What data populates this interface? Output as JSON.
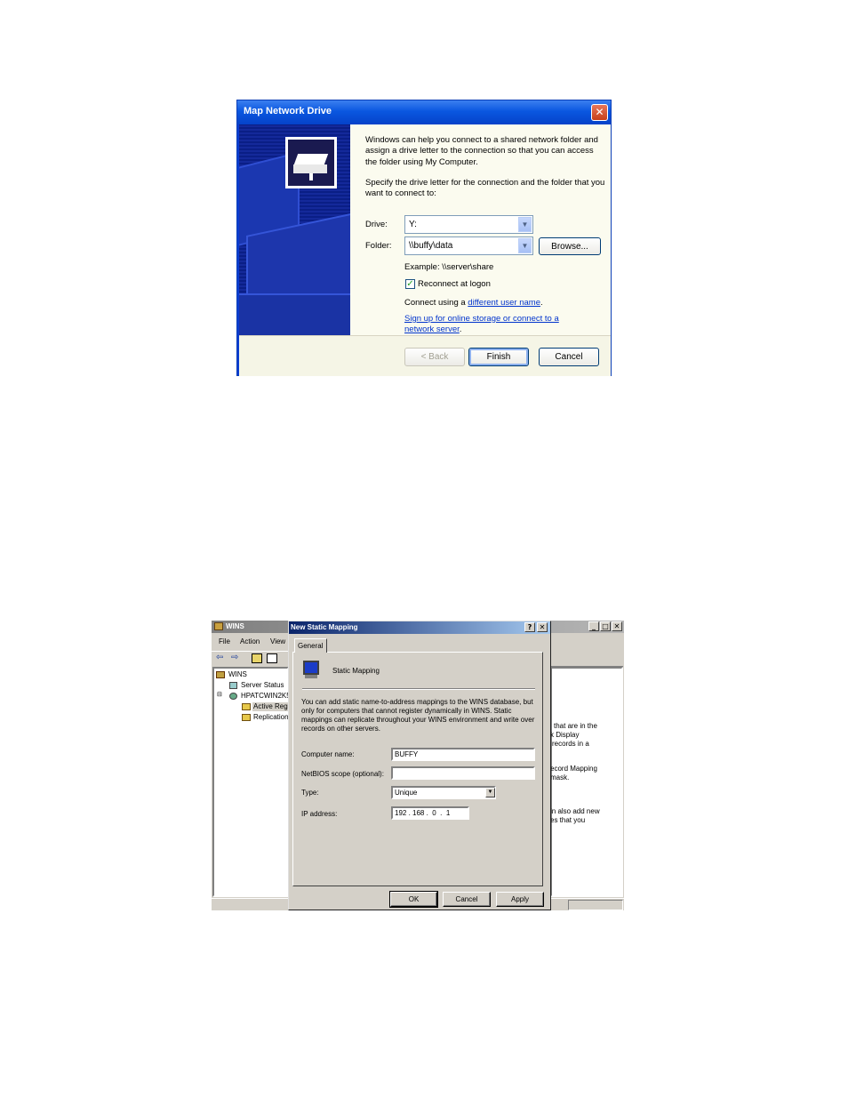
{
  "map_network_drive": {
    "title": "Map Network Drive",
    "intro": "Windows can help you connect to a shared network folder and assign a drive letter to the connection so that you can access the folder using My Computer.",
    "instruction": "Specify the drive letter for the connection and the folder that you want to connect to:",
    "drive_label": "Drive:",
    "drive_value": "Y:",
    "folder_label": "Folder:",
    "folder_value": "\\\\buffy\\data",
    "browse_label": "Browse...",
    "example": "Example: \\\\server\\share",
    "reconnect_label": "Reconnect at logon",
    "reconnect_checked": true,
    "connect_prefix": "Connect using a ",
    "connect_link": "different user name",
    "connect_suffix": ".",
    "signup_link_1": "Sign up for online storage or connect to a",
    "signup_link_2": "network server",
    "signup_suffix": ".",
    "back_label": "< Back",
    "finish_label": "Finish",
    "cancel_label": "Cancel"
  },
  "wins_console": {
    "title": "WINS",
    "menu": [
      "File",
      "Action",
      "View"
    ],
    "tree": {
      "root": "WINS",
      "server_status": "Server Status",
      "server": "HPATCWIN2K5",
      "active_reg": "Active Reg",
      "replication": "Replication"
    },
    "right_fragments": [
      [
        "that are in the",
        "k Display",
        "records in a"
      ],
      [
        "ecord Mapping",
        "mask."
      ],
      [
        "in also add new",
        "es that you"
      ]
    ]
  },
  "static_mapping": {
    "title": "New Static Mapping",
    "tab": "General",
    "heading": "Static Mapping",
    "description_lines": [
      "You can add static name-to-address mappings to the WINS database, but",
      "only for computers that cannot register dynamically in WINS. Static",
      "mappings can replicate throughout your WINS environment and write over",
      "records on other servers."
    ],
    "computer_name_label": "Computer name:",
    "computer_name_value": "BUFFY",
    "netbios_label": "NetBIOS scope (optional):",
    "netbios_value": "",
    "type_label": "Type:",
    "type_value": "Unique",
    "ip_label": "IP address:",
    "ip_value": "192 . 168 .  0  .  1",
    "ok_label": "OK",
    "cancel_label": "Cancel",
    "apply_label": "Apply"
  }
}
